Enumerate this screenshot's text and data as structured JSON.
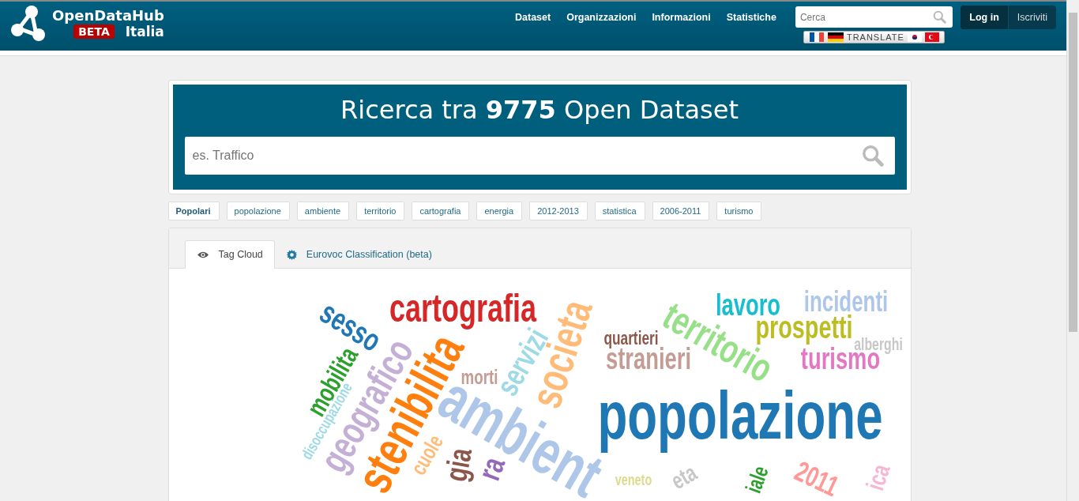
{
  "header": {
    "brand": "OpenDataHub",
    "badge": "BETA",
    "brand_sub": "Italia",
    "nav": [
      "Dataset",
      "Organizzazioni",
      "Informazioni",
      "Statistiche"
    ],
    "search": {
      "placeholder": "Cerca"
    },
    "translate": "TRANSLATE",
    "account": [
      {
        "label": "Log in",
        "selected": true
      },
      {
        "label": "Iscriviti",
        "selected": false
      }
    ]
  },
  "hero": {
    "title": "Ricerca tra **9775** Open Dataset",
    "search": {
      "placeholder": "es. Traffico"
    }
  },
  "tags": [
    {
      "label": "Popolari",
      "selected": true
    },
    {
      "label": "popolazione",
      "selected": false
    },
    {
      "label": "ambiente",
      "selected": false
    },
    {
      "label": "territorio",
      "selected": false
    },
    {
      "label": "cartografia",
      "selected": false
    },
    {
      "label": "energia",
      "selected": false
    },
    {
      "label": "2012-2013",
      "selected": false
    },
    {
      "label": "statistica",
      "selected": false
    },
    {
      "label": "2006-2011",
      "selected": false
    },
    {
      "label": "turismo",
      "selected": false
    }
  ],
  "tabs": [
    {
      "label": "Tag Cloud",
      "kind": "eye",
      "selected": true
    },
    {
      "label": "Eurovoc Classification (beta)",
      "kind": "gear",
      "selected": false
    }
  ],
  "cloud": [
    {
      "word": "cartografia",
      "color": "#d62728"
    },
    {
      "word": "sesso",
      "color": "#1f77b4"
    },
    {
      "word": "mobilita",
      "color": "#2ca02c"
    },
    {
      "word": "disoccupazione",
      "color": "#9edae5"
    },
    {
      "word": "geografico",
      "color": "#c5b0d5"
    },
    {
      "word": "stenibilita",
      "color": "#ff7f0e"
    },
    {
      "word": "morti",
      "color": "#c49c94"
    },
    {
      "word": "servizi",
      "color": "#9edae5"
    },
    {
      "word": "societa",
      "color": "#ffbb78"
    },
    {
      "word": "ambient",
      "color": "#aec7e8"
    },
    {
      "word": "quartieri",
      "color": "#8c564b"
    },
    {
      "word": "stranieri",
      "color": "#c49c94"
    },
    {
      "word": "territorio",
      "color": "#98df8a"
    },
    {
      "word": "lavoro",
      "color": "#17becf"
    },
    {
      "word": "incidenti",
      "color": "#aec7e8"
    },
    {
      "word": "prospetti",
      "color": "#bcbd22"
    },
    {
      "word": "alberghi",
      "color": "#c7c7c7"
    },
    {
      "word": "turismo",
      "color": "#e377c2"
    },
    {
      "word": "popolazione",
      "color": "#1f77b4"
    },
    {
      "word": "veneto",
      "color": "#dbdb8d"
    },
    {
      "word": "eta",
      "color": "#c7c7c7"
    },
    {
      "word": "iale",
      "color": "#2ca02c"
    },
    {
      "word": "2011",
      "color": "#ff9896"
    },
    {
      "word": "ica",
      "color": "#f7b6d2"
    },
    {
      "word": "cuole",
      "color": "#ffbb78"
    },
    {
      "word": "gia",
      "color": "#8c564b"
    },
    {
      "word": "ra",
      "color": "#9467bd"
    }
  ]
}
